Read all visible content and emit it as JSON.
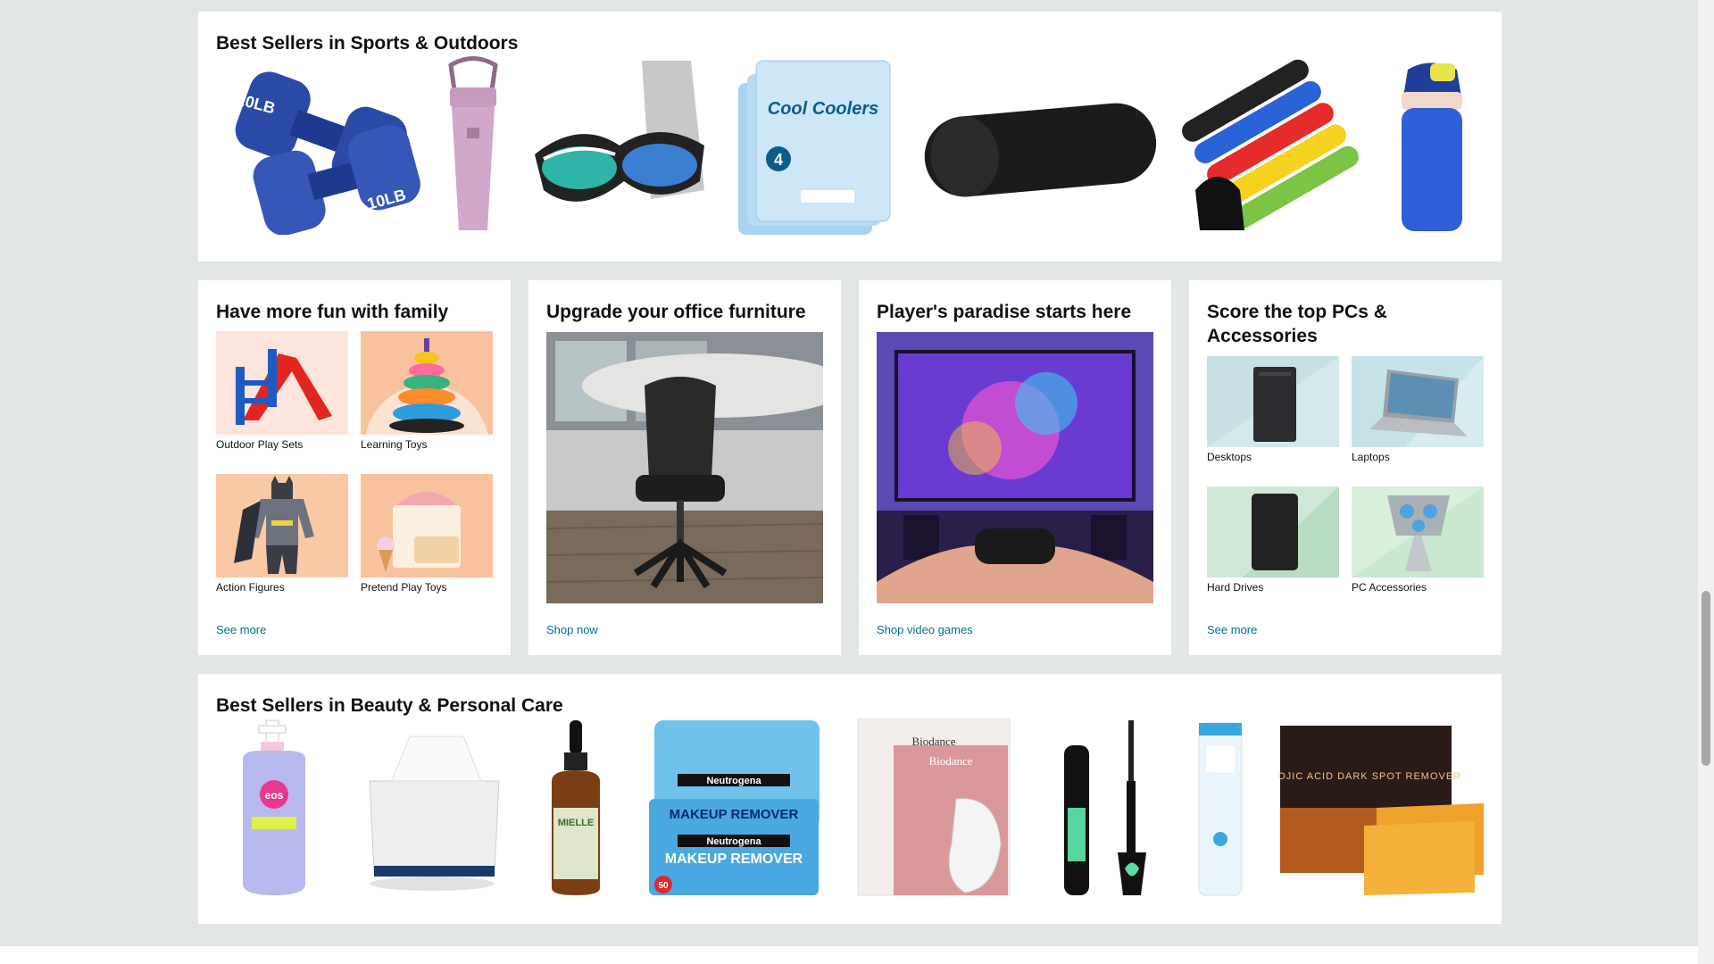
{
  "sports": {
    "title": "Best Sellers in Sports & Outdoors",
    "items": [
      "dumbbells-10lb",
      "stanley-tumbler",
      "swim-goggles",
      "cool-coolers-ice-packs",
      "foam-roller",
      "resistance-bands",
      "owala-bottle"
    ],
    "dumbbell_text": "10LB",
    "ice_brand": "Cool Coolers",
    "ice_count": "4"
  },
  "family": {
    "title": "Have more fun with family",
    "tiles": [
      {
        "label": "Outdoor Play Sets"
      },
      {
        "label": "Learning Toys"
      },
      {
        "label": "Action Figures"
      },
      {
        "label": "Pretend Play Toys"
      }
    ],
    "link": "See more"
  },
  "office": {
    "title": "Upgrade your office furniture",
    "link": "Shop now"
  },
  "gaming": {
    "title": "Player's paradise starts here",
    "link": "Shop video games"
  },
  "pcs": {
    "title": "Score the top PCs & Accessories",
    "tiles": [
      {
        "label": "Desktops"
      },
      {
        "label": "Laptops"
      },
      {
        "label": "Hard Drives"
      },
      {
        "label": "PC Accessories"
      }
    ],
    "link": "See more"
  },
  "beauty": {
    "title": "Best Sellers in Beauty & Personal Care",
    "items": [
      "eos-body-lotion",
      "clean-skin-towels",
      "mielle-oil",
      "neutrogena-makeup-remover",
      "biodance-mask",
      "essence-mascara",
      "cotton-rounds",
      "kojic-acid-soap"
    ],
    "neutro_brand": "Neutrogena",
    "neutro_line": "MAKEUP REMOVER",
    "neutro_count": "50",
    "bio_brand": "Biodance",
    "kojic_text": "KOJIC ACID DARK SPOT REMOVER",
    "eos_brand": "eos",
    "mielle_brand": "MIELLE"
  },
  "colors": {
    "background": "#e3e6e6",
    "link": "#007185",
    "card": "#ffffff"
  }
}
